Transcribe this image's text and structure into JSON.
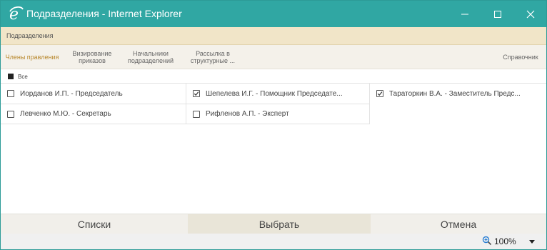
{
  "window": {
    "title": "Подразделения - Internet Explorer",
    "title_bar_color": "#30a7a3",
    "app_icon": "internet-explorer-icon",
    "controls": [
      "minimize-icon",
      "maximize-icon",
      "close-icon"
    ]
  },
  "subheader": {
    "label": "Подразделения",
    "color": "#f1e5c8"
  },
  "tabs": [
    {
      "label": "Члены правления",
      "active": true
    },
    {
      "label": "Визирование приказов",
      "active": false
    },
    {
      "label": "Начальники подразделений",
      "active": false
    },
    {
      "label": "Рассылка в структурные ...",
      "active": false
    }
  ],
  "reference_tab": {
    "label": "Справочник"
  },
  "select_all": {
    "label": "Все",
    "state": "indeterminate"
  },
  "members": [
    {
      "label": "Иорданов И.П. - Председатель",
      "checked": false
    },
    {
      "label": "Шепелева И.Г. - Помощник Председате...",
      "checked": true
    },
    {
      "label": "Тараторкин В.А. - Заместитель Предс...",
      "checked": true
    },
    {
      "label": "Левченко М.Ю. - Секретарь",
      "checked": false
    },
    {
      "label": "Рифленов А.П. - Эксперт",
      "checked": false
    }
  ],
  "footer": {
    "lists_label": "Списки",
    "select_label": "Выбрать",
    "cancel_label": "Отмена"
  },
  "statusbar": {
    "zoom_icon": "zoom-icon",
    "zoom": "100%"
  },
  "colors": {
    "accent_tab": "#b9892f",
    "footer_selected": "#e9e5d8"
  }
}
